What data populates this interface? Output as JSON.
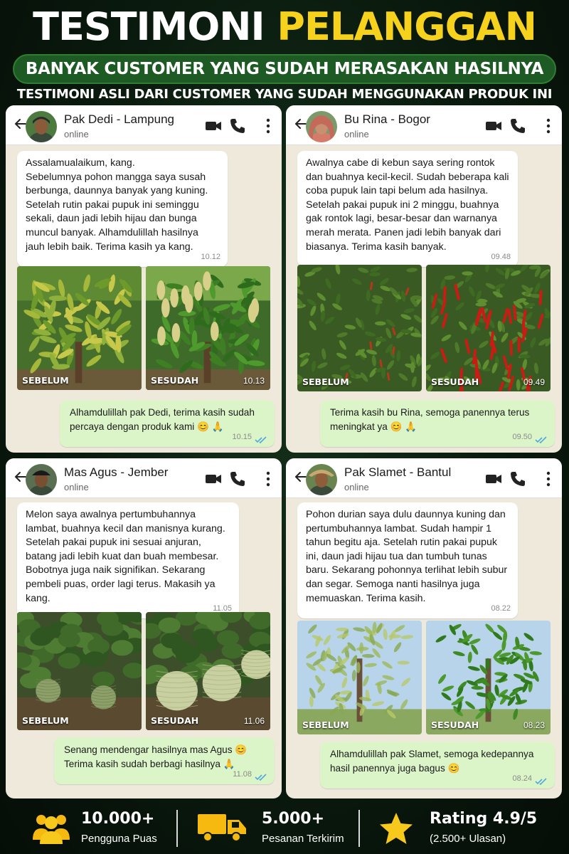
{
  "header": {
    "title_white": "TESTIMONI",
    "title_yellow": "PELANGGAN",
    "banner": "BANYAK CUSTOMER YANG SUDAH MERASAKAN HASILNYA",
    "subtitle": "TESTIMONI ASLI DARI CUSTOMER YANG SUDAH MENGGUNAKAN PRODUK INI"
  },
  "colors": {
    "accent_yellow": "#f7d21c",
    "banner_green": "#1e5a24",
    "bubble_out": "#dcf5c8",
    "chat_bg": "#efe9dc"
  },
  "chats": [
    {
      "name": "Pak Dedi - Lampung",
      "status": "online",
      "message": "Assalamualaikum, kang.\nSebelumnya pohon mangga saya susah berbunga, daunnya banyak yang kuning. Setelah rutin pakai pupuk ini seminggu sekali, daun jadi lebih hijau dan bunga muncul banyak. Alhamdulillah hasilnya jauh lebih baik. Terima kasih ya kang.",
      "message_time": "10.12",
      "before_label": "SEBELUM",
      "after_label": "SESUDAH",
      "photo_time": "10.13",
      "reply": "Alhamdulillah pak Dedi, terima kasih sudah percaya dengan produk kami 😊 🙏",
      "reply_time": "10.15",
      "photo_subject": "mango"
    },
    {
      "name": "Bu Rina - Bogor",
      "status": "online",
      "message": "Awalnya cabe di kebun saya sering rontok dan buahnya kecil-kecil. Sudah beberapa kali coba pupuk lain tapi belum ada hasilnya. Setelah pakai pupuk ini 2 minggu, buahnya gak rontok lagi, besar-besar dan warnanya merah merata. Panen jadi lebih banyak dari biasanya. Terima kasih banyak.",
      "message_time": "09.48",
      "before_label": "SEBELUM",
      "after_label": "SESUDAH",
      "photo_time": "09.49",
      "reply": "Terima kasih bu Rina, semoga panennya terus meningkat ya 😊 🙏",
      "reply_time": "09.50",
      "photo_subject": "chili"
    },
    {
      "name": "Mas Agus - Jember",
      "status": "online",
      "message": "Melon saya awalnya pertumbuhannya lambat, buahnya kecil dan manisnya kurang. Setelah pakai pupuk ini sesuai anjuran, batang jadi lebih kuat dan buah membesar. Bobotnya juga naik signifikan. Sekarang pembeli puas, order lagi terus. Makasih ya kang.",
      "message_time": "11.05",
      "before_label": "SEBELUM",
      "after_label": "SESUDAH",
      "photo_time": "11.06",
      "reply": "Senang mendengar hasilnya mas Agus 😊\nTerima kasih sudah berbagi hasilnya 🙏",
      "reply_time": "11.08",
      "photo_subject": "melon"
    },
    {
      "name": "Pak Slamet - Bantul",
      "status": "online",
      "message": "Pohon durian saya dulu daunnya kuning dan pertumbuhannya lambat. Sudah hampir 1 tahun begitu aja. Setelah rutin pakai pupuk ini, daun jadi hijau tua dan tumbuh tunas baru. Sekarang pohonnya terlihat lebih subur dan segar. Semoga nanti hasilnya juga memuaskan. Terima kasih.",
      "message_time": "08.22",
      "before_label": "SEBELUM",
      "after_label": "SESUDAH",
      "photo_time": "08.23",
      "reply": "Alhamdulillah pak Slamet, semoga kedepannya hasil panennya juga bagus 😊",
      "reply_time": "08.24",
      "photo_subject": "durian"
    }
  ],
  "footer": {
    "stats": [
      {
        "icon": "users-icon",
        "value": "10.000+",
        "label": "Pengguna Puas"
      },
      {
        "icon": "truck-icon",
        "value": "5.000+",
        "label": "Pesanan Terkirim"
      },
      {
        "icon": "star-icon",
        "value": "Rating 4.9/5",
        "label": "(2.500+ Ulasan)"
      }
    ]
  }
}
